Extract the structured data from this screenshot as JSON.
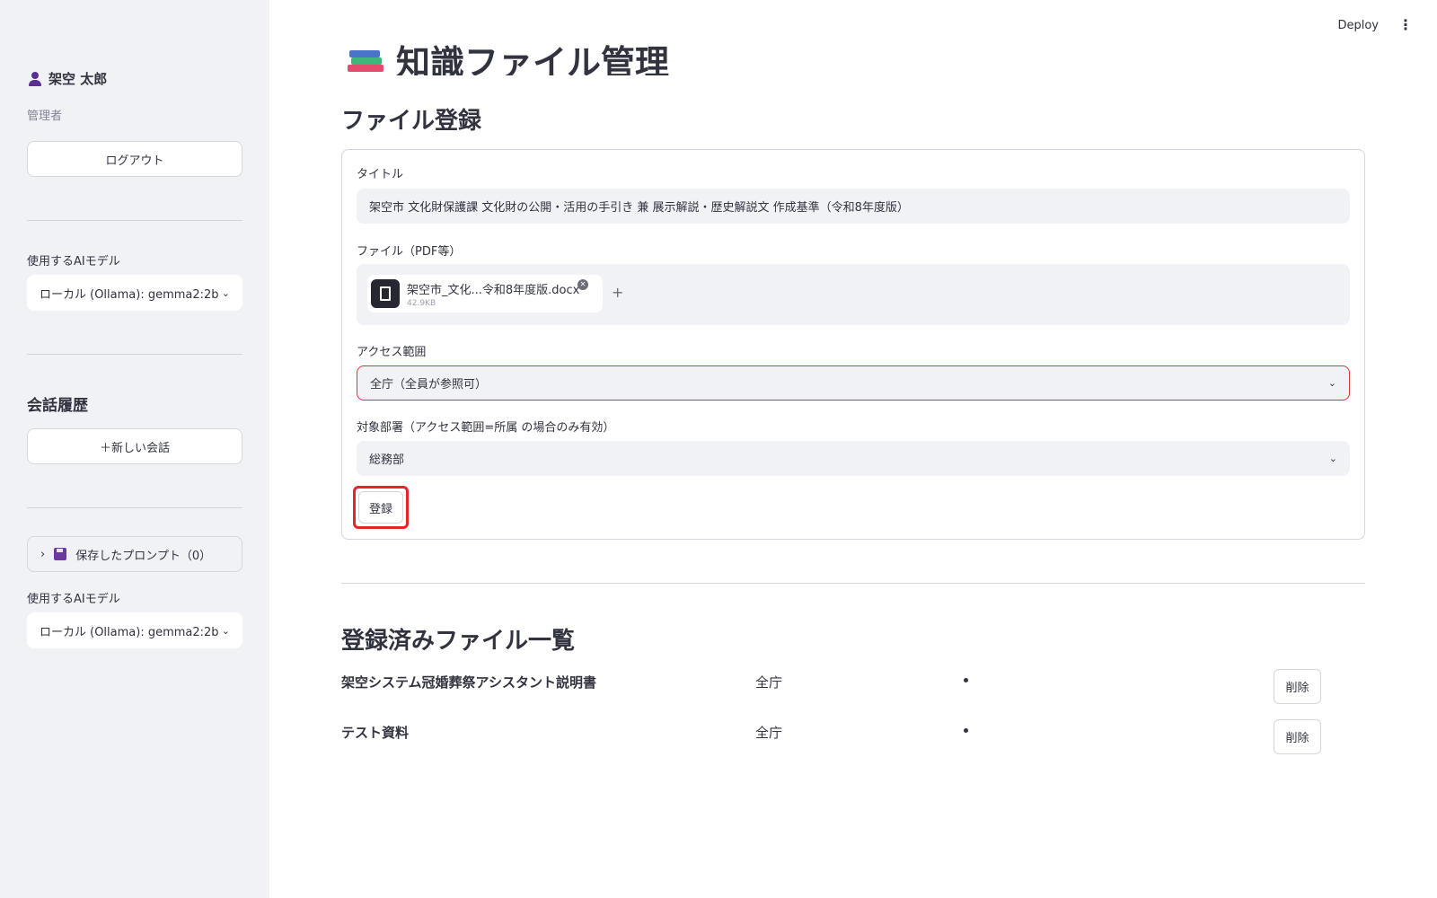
{
  "header": {
    "deploy_label": "Deploy",
    "menu_icon": "⋮"
  },
  "sidebar": {
    "user_name": "架空 太郎",
    "user_role": "管理者",
    "logout_label": "ログアウト",
    "model_label": "使用するAIモデル",
    "model_value": "ローカル (Ollama): gemma2:2b",
    "history_title": "会話履歴",
    "new_chat_label": "＋新しい会話",
    "saved_prompts_label": "保存したプロンプト（0）",
    "model_label_2": "使用するAIモデル",
    "model_value_2": "ローカル (Ollama): gemma2:2b"
  },
  "main": {
    "page_title": "知識ファイル管理",
    "register_section_title": "ファイル登録",
    "form": {
      "title_label": "タイトル",
      "title_value": "架空市 文化財保護課 文化財の公開・活用の手引き 兼 展示解説・歴史解説文 作成基準（令和8年度版）",
      "file_label": "ファイル（PDF等）",
      "file_name": "架空市_文化...令和8年度版.docx",
      "file_size": "42.9KB",
      "access_label": "アクセス範囲",
      "access_value": "全庁（全員が参照可）",
      "dept_label": "対象部署（アクセス範囲=所属 の場合のみ有効）",
      "dept_value": "総務部",
      "submit_label": "登録"
    },
    "list_section_title": "登録済みファイル一覧",
    "files": [
      {
        "title": "架空システム冠婚葬祭アシスタント説明書",
        "access": "全庁",
        "delete_label": "削除"
      },
      {
        "title": "テスト資料",
        "access": "全庁",
        "delete_label": "削除"
      }
    ]
  },
  "colors": {
    "sidebar_bg": "#f0f2f6",
    "error_border": "#e8303a",
    "highlight_border": "#e8252c",
    "text": "#31333f"
  }
}
